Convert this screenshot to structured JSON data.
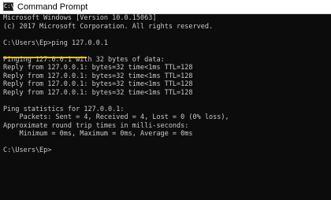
{
  "window": {
    "title": "Command Prompt",
    "icon": "cmd-icon",
    "icon_glyph": "C:\\"
  },
  "console": {
    "lines": [
      "Microsoft Windows [Version 10.0.15063]",
      "(c) 2017 Microsoft Corporation. All rights reserved.",
      "",
      "C:\\Users\\Ep>ping 127.0.0.1",
      "",
      "Pinging 127.0.0.1 with 32 bytes of data:",
      "Reply from 127.0.0.1: bytes=32 time<1ms TTL=128",
      "Reply from 127.0.0.1: bytes=32 time<1ms TTL=128",
      "Reply from 127.0.0.1: bytes=32 time<1ms TTL=128",
      "Reply from 127.0.0.1: bytes=32 time<1ms TTL=128",
      "",
      "Ping statistics for 127.0.0.1:",
      "    Packets: Sent = 4, Received = 4, Lost = 0 (0% loss),",
      "Approximate round trip times in milli-seconds:",
      "    Minimum = 0ms, Maximum = 0ms, Average = 0ms",
      "",
      "C:\\Users\\Ep>"
    ]
  },
  "colors": {
    "console_bg": "#0c0c0c",
    "console_text": "#c8c8c8",
    "highlight_underline": "#f2c40e"
  }
}
